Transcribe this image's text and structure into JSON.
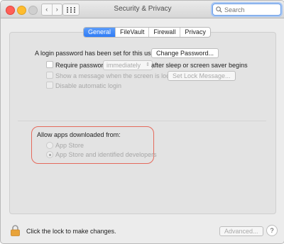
{
  "window": {
    "title": "Security & Privacy"
  },
  "toolbar": {
    "back_glyph": "‹",
    "forward_glyph": "›",
    "grid_icon": "grid-icon"
  },
  "search": {
    "placeholder": "Search",
    "value": ""
  },
  "tabs": [
    {
      "label": "General",
      "active": true
    },
    {
      "label": "FileVault",
      "active": false
    },
    {
      "label": "Firewall",
      "active": false
    },
    {
      "label": "Privacy",
      "active": false
    }
  ],
  "general": {
    "login_password_text": "A login password has been set for this user",
    "change_password_button": "Change Password...",
    "require_password_label": "Require password",
    "require_password_select": "immediately",
    "require_password_suffix": "after sleep or screen saver begins",
    "show_message_label": "Show a message when the screen is locked",
    "set_lock_message_button": "Set Lock Message...",
    "disable_auto_login_label": "Disable automatic login"
  },
  "allow_apps": {
    "heading": "Allow apps downloaded from:",
    "options": [
      {
        "label": "App Store",
        "selected": false
      },
      {
        "label": "App Store and identified developers",
        "selected": true
      }
    ]
  },
  "footer": {
    "lock_text": "Click the lock to make changes.",
    "advanced_button": "Advanced...",
    "help_label": "?"
  },
  "colors": {
    "accent": "#2f7cf6",
    "highlight_ring": "#e56a5c",
    "lock_body": "#e8a33a"
  }
}
